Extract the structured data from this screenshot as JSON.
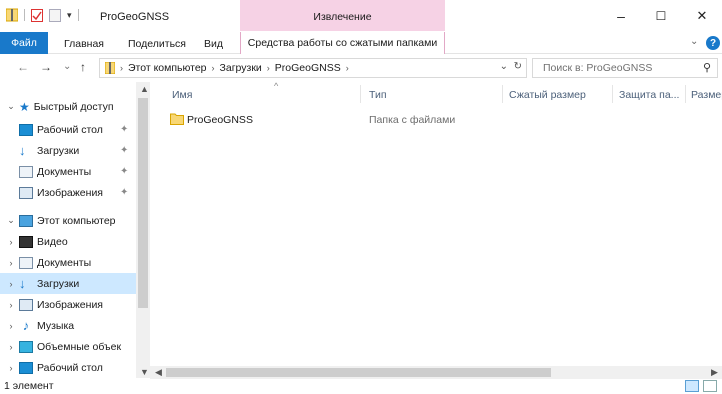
{
  "window": {
    "title": "ProGeoGNSS",
    "context_group": "Извлечение",
    "minimize": "–",
    "maximize": "☐",
    "close": "✕"
  },
  "ribbon": {
    "tabs": [
      "Файл",
      "Главная",
      "Поделиться",
      "Вид"
    ],
    "context_tab": "Средства работы со сжатыми папками",
    "expand": "⌄",
    "help": "?"
  },
  "navigation": {
    "back": "←",
    "forward": "→",
    "recent": "⌄",
    "up": "↑",
    "breadcrumb": [
      "Этот компьютер",
      "Загрузки",
      "ProGeoGNSS"
    ],
    "refresh": "↻",
    "dropdown": "⌄",
    "search_placeholder": "Поиск в: ProGeoGNSS"
  },
  "sidebar": {
    "quick_access": "Быстрый доступ",
    "quick_items": [
      "Рабочий стол",
      "Загрузки",
      "Документы",
      "Изображения"
    ],
    "this_pc": "Этот компьютер",
    "pc_items": [
      "Видео",
      "Документы",
      "Загрузки",
      "Изображения",
      "Музыка",
      "Объемные объек",
      "Рабочий стол"
    ],
    "selected": "Загрузки"
  },
  "columns": [
    "Имя",
    "Тип",
    "Сжатый размер",
    "Защита па...",
    "Размер"
  ],
  "files": [
    {
      "name": "ProGeoGNSS",
      "type": "Папка с файлами"
    }
  ],
  "status": {
    "count": "1 элемент"
  },
  "colors": {
    "accent": "#1979ca",
    "context_header": "#f6d2e5",
    "selected_row": "#cde8ff",
    "folder": "#f8d775"
  }
}
